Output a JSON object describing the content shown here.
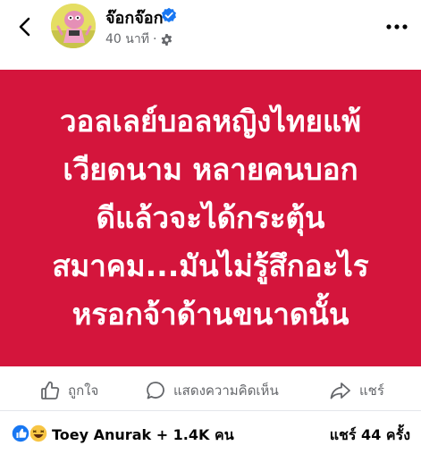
{
  "header": {
    "author_name": "จ๊อกจ๊อก",
    "timestamp": "40 นาที",
    "separator": "·"
  },
  "post": {
    "lines": [
      "วอลเลย์บอลหญิงไทยแพ้",
      "เวียดนาม หลายคนบอก",
      "ดีแล้วจะได้กระตุ้น",
      "สมาคม...มันไม่รู้สึกอะไร",
      "หรอกจ้าด้านขนาดนั้น"
    ],
    "background_color": "#d4153c",
    "text_color": "#ffffff"
  },
  "actions": {
    "like_label": "ถูกใจ",
    "comment_label": "แสดงความคิดเห็น",
    "share_label": "แชร์"
  },
  "footer": {
    "reactors_text": "Toey Anurak + 1.4K คน",
    "shares_text": "แชร์ 44 ครั้ง"
  },
  "icons": {
    "back": "chevron-left-icon",
    "verified": "verified-badge-icon",
    "privacy": "gear-icon",
    "more": "more-dots-icon",
    "like": "thumbs-up-icon",
    "comment": "comment-bubble-icon",
    "share": "share-arrow-icon",
    "reaction_like": "like-reaction-icon",
    "reaction_haha": "haha-reaction-icon"
  },
  "colors": {
    "verified_blue": "#1877f2",
    "secondary_text": "#65676b"
  }
}
